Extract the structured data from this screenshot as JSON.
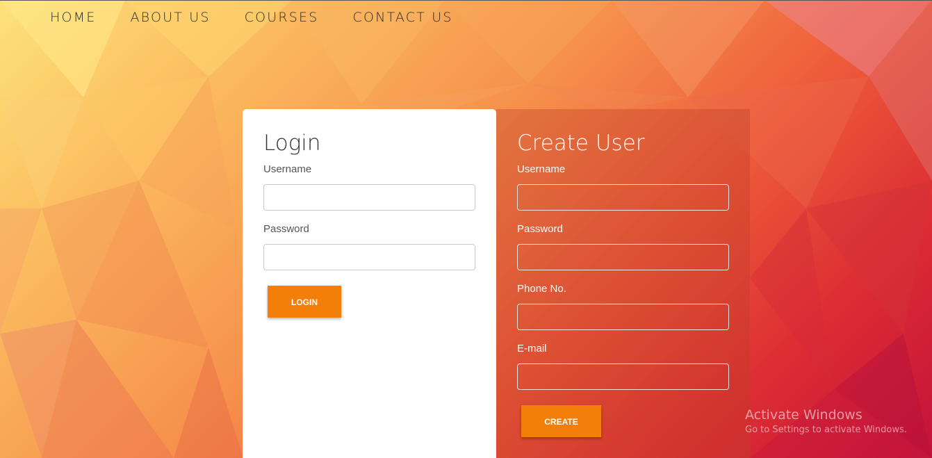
{
  "nav": {
    "items": [
      {
        "label": "HOME"
      },
      {
        "label": "ABOUT US"
      },
      {
        "label": "COURSES"
      },
      {
        "label": "CONTACT US"
      }
    ]
  },
  "login": {
    "title": "Login",
    "username_label": "Username",
    "username_value": "",
    "password_label": "Password",
    "password_value": "",
    "button_label": "LOGIN"
  },
  "create_user": {
    "title": "Create User",
    "username_label": "Username",
    "username_value": "",
    "password_label": "Password",
    "password_value": "",
    "phone_label": "Phone No.",
    "phone_value": "",
    "email_label": "E-mail",
    "email_value": "",
    "button_label": "CREATE"
  },
  "watermark": {
    "title": "Activate Windows",
    "subtitle": "Go to Settings to activate Windows."
  },
  "colors": {
    "accent_button": "#f37f0a",
    "background_start": "#fde27a",
    "background_end": "#c4123a"
  }
}
